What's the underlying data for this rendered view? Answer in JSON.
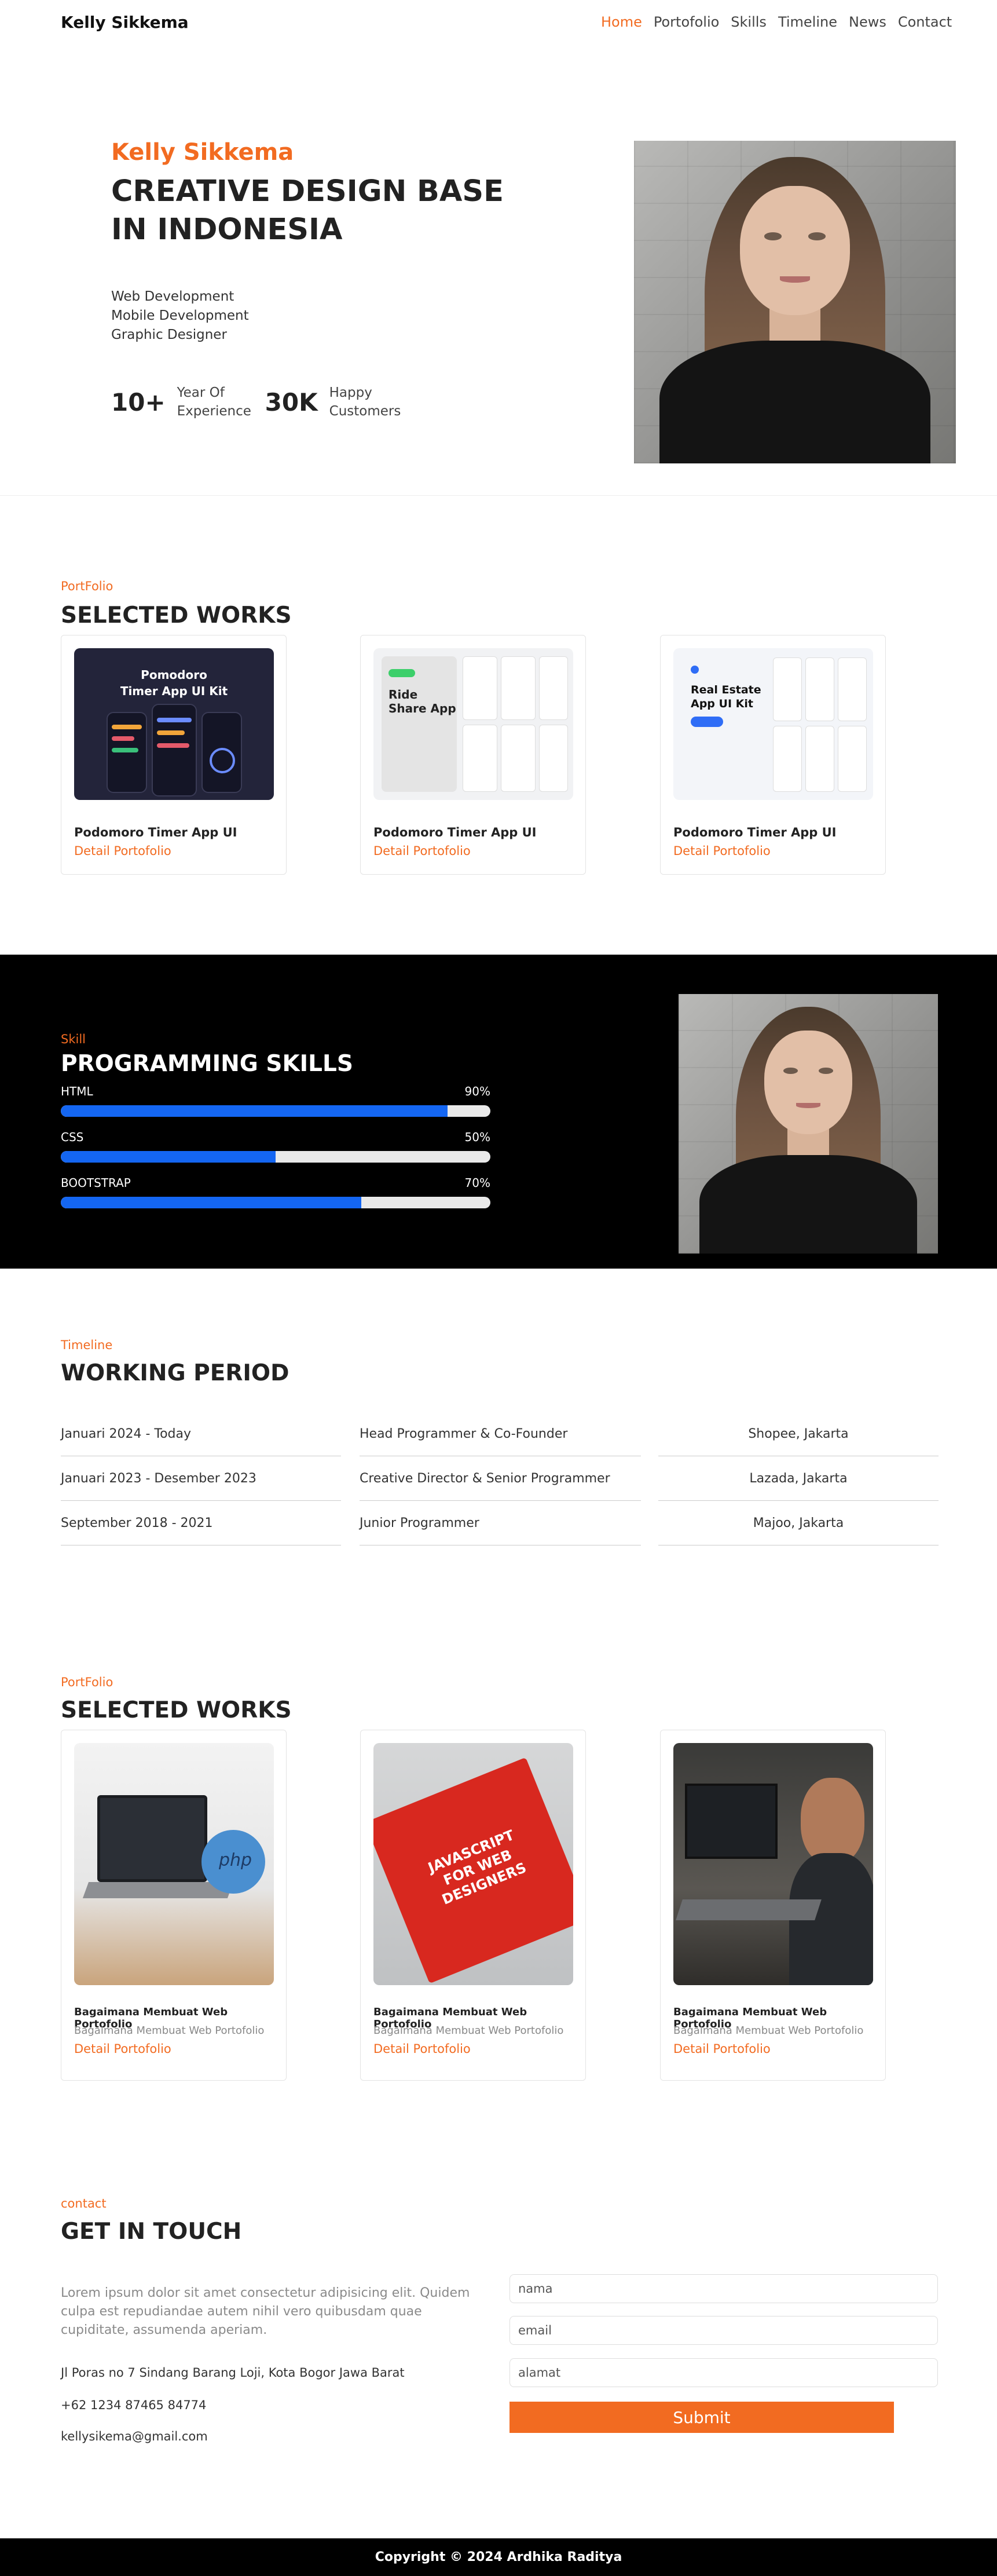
{
  "nav": {
    "brand": "Kelly Sikkema",
    "links": [
      "Home",
      "Portofolio",
      "Skills",
      "Timeline",
      "News",
      "Contact"
    ],
    "active_index": 0
  },
  "hero": {
    "name": "Kelly Sikkema",
    "title": "CREATIVE DESIGN BASE IN INDONESIA",
    "roles": [
      "Web Development",
      "Mobile Development",
      "Graphic Designer"
    ],
    "stats": [
      {
        "number": "10+",
        "label_line1": "Year Of",
        "label_line2": "Experience"
      },
      {
        "number": "30K",
        "label_line1": "Happy",
        "label_line2": "Customers"
      }
    ]
  },
  "portfolio": {
    "eyebrow": "PortFolio",
    "title": "SELECTED WORKS",
    "items": [
      {
        "title": "Podomoro Timer App UI",
        "link": "Detail Portofolio",
        "thumb_lines": [
          "Pomodoro",
          "Timer App UI Kit"
        ]
      },
      {
        "title": "Podomoro Timer App UI",
        "link": "Detail Portofolio",
        "thumb_lines": [
          "Ride",
          "Share App"
        ]
      },
      {
        "title": "Podomoro Timer App UI",
        "link": "Detail Portofolio",
        "thumb_lines": [
          "Real Estate",
          "App UI Kit"
        ]
      }
    ]
  },
  "skills": {
    "eyebrow": "Skill",
    "title": "PROGRAMMING SKILLS",
    "items": [
      {
        "name": "HTML",
        "percent_label": "90%",
        "percent": 90
      },
      {
        "name": "CSS",
        "percent_label": "50%",
        "percent": 50
      },
      {
        "name": "BOOTSTRAP",
        "percent_label": "70%",
        "percent": 70
      }
    ],
    "bar_color": "#1466f2"
  },
  "timeline": {
    "eyebrow": "Timeline",
    "title": "WORKING PERIOD",
    "rows": [
      {
        "period": "Januari 2024 - Today",
        "role": "Head Programmer & Co-Founder",
        "place": "Shopee, Jakarta"
      },
      {
        "period": "Januari 2023 - Desember 2023",
        "role": "Creative Director & Senior Programmer",
        "place": "Lazada, Jakarta"
      },
      {
        "period": "September 2018 - 2021",
        "role": "Junior Programmer",
        "place": "Majoo, Jakarta"
      }
    ]
  },
  "news": {
    "eyebrow": "PortFolio",
    "title": "SELECTED WORKS",
    "items": [
      {
        "title": "Bagaimana Membuat Web Portofolio",
        "subtitle": "Bagaimana Membuat Web Portofolio",
        "link": "Detail Portofolio",
        "thumb_text": "php"
      },
      {
        "title": "Bagaimana Membuat Web Portofolio",
        "subtitle": "Bagaimana Membuat Web Portofolio",
        "link": "Detail Portofolio",
        "thumb_text": "JAVASCRIPT FOR WEB DESIGNERS"
      },
      {
        "title": "Bagaimana Membuat Web Portofolio",
        "subtitle": "Bagaimana Membuat Web Portofolio",
        "link": "Detail Portofolio",
        "thumb_text": ""
      }
    ]
  },
  "contact": {
    "eyebrow": "contact",
    "title": "GET IN TOUCH",
    "text": "Lorem ipsum dolor sit amet consectetur adipisicing elit. Quidem culpa est repudiandae autem nihil vero quibusdam quae cupiditate, assumenda aperiam.",
    "address": "Jl Poras no 7 Sindang Barang Loji, Kota Bogor Jawa Barat",
    "phone": "+62 1234 87465 84774",
    "email": "kellysikema@gmail.com",
    "fields": {
      "name_placeholder": "nama",
      "email_placeholder": "email",
      "address_placeholder": "alamat"
    },
    "submit_label": "Submit"
  },
  "footer": {
    "text": "Copyright © 2024 Ardhika Raditya"
  },
  "colors": {
    "accent": "#f26b21",
    "dark": "#000000",
    "text": "#222222"
  }
}
